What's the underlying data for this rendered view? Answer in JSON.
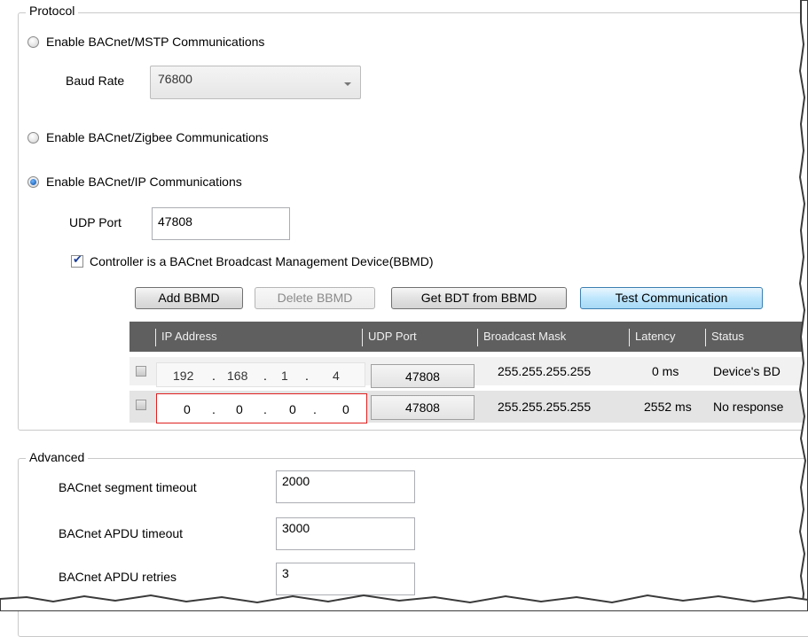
{
  "protocol": {
    "title": "Protocol",
    "mstp": {
      "label": "Enable BACnet/MSTP Communications",
      "selected": false
    },
    "baud_rate": {
      "label": "Baud Rate",
      "value": "76800"
    },
    "zigbee": {
      "label": "Enable BACnet/Zigbee Communications",
      "selected": false
    },
    "ip": {
      "label": "Enable BACnet/IP Communications",
      "selected": true
    },
    "udp_port": {
      "label": "UDP Port",
      "value": "47808"
    },
    "bbmd_checkbox": {
      "label": "Controller is a BACnet Broadcast Management Device(BBMD)",
      "checked": true
    },
    "buttons": {
      "add": "Add BBMD",
      "delete": "Delete BBMD",
      "get_bdt": "Get BDT from BBMD",
      "test": "Test Communication"
    },
    "table": {
      "headers": [
        "IP Address",
        "UDP Port",
        "Broadcast Mask",
        "Latency",
        "Status"
      ],
      "rows": [
        {
          "ip": [
            "192",
            "168",
            "1",
            "4"
          ],
          "port": "47808",
          "mask": "255.255.255.255",
          "latency": "0 ms",
          "status": "Device's BD"
        },
        {
          "ip": [
            "0",
            "0",
            "0",
            "0"
          ],
          "port": "47808",
          "mask": "255.255.255.255",
          "latency": "2552 ms",
          "status": "No response"
        }
      ]
    }
  },
  "advanced": {
    "title": "Advanced",
    "segment_timeout": {
      "label": "BACnet segment timeout",
      "value": "2000"
    },
    "apdu_timeout": {
      "label": "BACnet APDU timeout",
      "value": "3000"
    },
    "apdu_retries": {
      "label": "BACnet APDU retries",
      "value": "3"
    }
  },
  "colors": {
    "header_bg": "#5f5f5f",
    "selected_row_border": "#e02020",
    "radio_selected": "#1a5fb4"
  }
}
